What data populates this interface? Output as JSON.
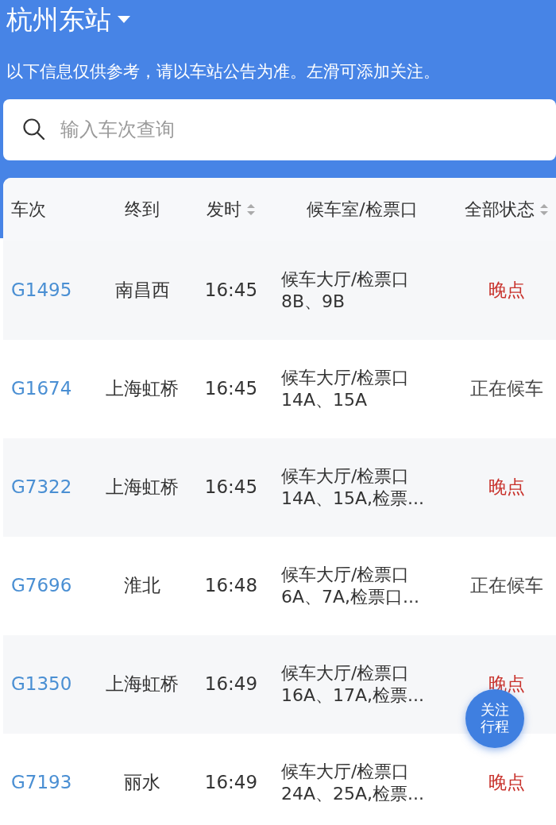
{
  "station": {
    "title": "杭州东站"
  },
  "notice": "以下信息仅供参考，请以车站公告为准。左滑可添加关注。",
  "search": {
    "placeholder": "输入车次查询"
  },
  "table": {
    "columns": [
      {
        "label": "车次",
        "sortable": false
      },
      {
        "label": "终到",
        "sortable": false
      },
      {
        "label": "发时",
        "sortable": true
      },
      {
        "label": "候车室/检票口",
        "sortable": false
      },
      {
        "label": "全部状态",
        "sortable": true
      }
    ],
    "rows": [
      {
        "train": "G1495",
        "destination": "南昌西",
        "time": "16:45",
        "gate_line1": "候车大厅/检票口",
        "gate_line2": "8B、9B",
        "status": "晚点",
        "kind": "late"
      },
      {
        "train": "G1674",
        "destination": "上海虹桥",
        "time": "16:45",
        "gate_line1": "候车大厅/检票口",
        "gate_line2": "14A、15A",
        "status": "正在候车",
        "kind": "waiting"
      },
      {
        "train": "G7322",
        "destination": "上海虹桥",
        "time": "16:45",
        "gate_line1": "候车大厅/检票口",
        "gate_line2": "14A、15A,检票...",
        "status": "晚点",
        "kind": "late"
      },
      {
        "train": "G7696",
        "destination": "淮北",
        "time": "16:48",
        "gate_line1": "候车大厅/检票口",
        "gate_line2": "6A、7A,检票口...",
        "status": "正在候车",
        "kind": "waiting"
      },
      {
        "train": "G1350",
        "destination": "上海虹桥",
        "time": "16:49",
        "gate_line1": "候车大厅/检票口",
        "gate_line2": "16A、17A,检票...",
        "status": "晚点",
        "kind": "late"
      },
      {
        "train": "G7193",
        "destination": "丽水",
        "time": "16:49",
        "gate_line1": "候车大厅/检票口",
        "gate_line2": "24A、25A,检票...",
        "status": "晚点",
        "kind": "late"
      }
    ]
  },
  "follow_button": {
    "line1": "关注",
    "line2": "行程"
  }
}
